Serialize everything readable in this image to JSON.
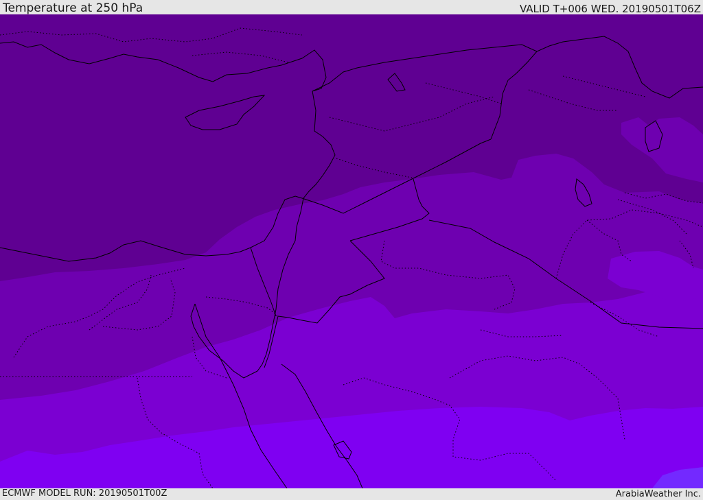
{
  "header": {
    "title": "Temperature at 250 hPa",
    "valid": "VALID T+006 WED. 20190501T06Z"
  },
  "footer": {
    "model_run": "ECMWF MODEL RUN: 20190501T00Z",
    "credit": "ArabiaWeather Inc."
  },
  "colors": {
    "band_coldest": "#5f0092",
    "band_cold": "#6e00b0",
    "band_mid": "#7b00d2",
    "band_warm": "#7f00f2",
    "band_warmest": "#7329ff",
    "coastline": "#000000",
    "background": "#e6e6e6"
  }
}
